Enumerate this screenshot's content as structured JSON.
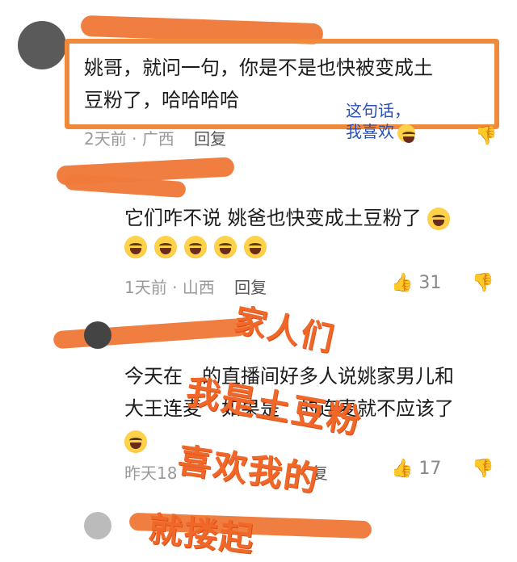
{
  "comments": [
    {
      "text_line1": "姚哥，就问一句，你是不是也快被变成土",
      "text_line2": "豆粉了，哈哈哈哈",
      "time": "2天前",
      "location": "广西",
      "reply": "回复"
    },
    {
      "text": "它们咋不说 姚爸也快变成土豆粉了",
      "time": "1天前",
      "location": "山西",
      "reply": "回复",
      "likes": "31"
    },
    {
      "text_line1": "今天在",
      "text_line1b": "的直播间好多人说姚家男儿和",
      "text_line2a": "大王连麦",
      "text_line2b": "如果是",
      "text_line2c": "的连麦就不应该了",
      "time": "昨天18",
      "reply": "复",
      "likes": "17"
    }
  ],
  "annotation_note": {
    "line1": "这句话，",
    "line2": "我喜欢"
  },
  "overlay": {
    "line1": "家人们",
    "line2": "我是土豆粉",
    "line3": "喜欢我的",
    "line4": "就搂起"
  },
  "colors": {
    "scribble": "#f07a3a",
    "overlay_text": "#f0672a",
    "box": "#f08a3a",
    "note": "#2a4fb5"
  }
}
